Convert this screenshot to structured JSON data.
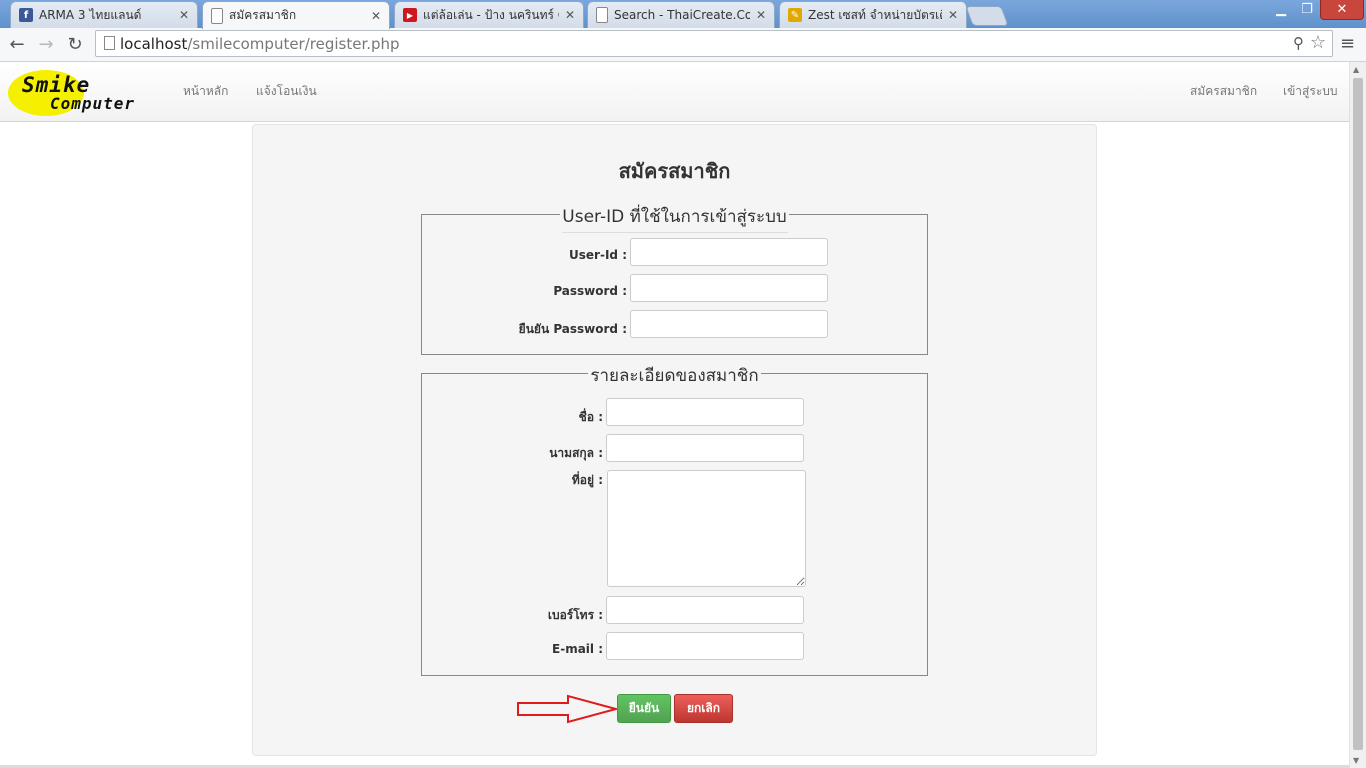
{
  "browser": {
    "tabs": [
      {
        "title": "ARMA 3 ไทยแลนด์",
        "icon": "facebook-icon",
        "color": "#3b5998"
      },
      {
        "title": "สมัครสมาชิก",
        "icon": "page-icon",
        "color": "#888888"
      },
      {
        "title": "แต่ล้อเล่น - ป้าง นครินทร์ Offi",
        "icon": "youtube-icon",
        "color": "#cc181e"
      },
      {
        "title": "Search - ThaiCreate.Com",
        "icon": "page-icon",
        "color": "#888888"
      },
      {
        "title": "Zest เซสท์ จำหน่ายบัตรเติมเงิน",
        "icon": "zest-icon",
        "color": "#e0a800"
      }
    ],
    "url_host": "localhost",
    "url_path": "/smilecomputer/register.php"
  },
  "navbar": {
    "logo_line1": "Smike",
    "logo_line2": "Computer",
    "links_left": [
      "หน้าหลัก",
      "แจ้งโอนเงิน"
    ],
    "links_right": [
      "สมัครสมาชิก",
      "เข้าสู่ระบบ"
    ]
  },
  "form": {
    "title": "สมัครสมาชิก",
    "account_group": {
      "legend": "User-ID ที่ใช้ในการเข้าสู่ระบบ",
      "fields": [
        {
          "label": "User-Id :",
          "value": ""
        },
        {
          "label": "Password :",
          "value": ""
        },
        {
          "label": "ยืนยัน Password :",
          "value": ""
        }
      ]
    },
    "details_group": {
      "legend": "รายละเอียดของสมาชิก",
      "fields": [
        {
          "label": "ชื่อ :",
          "value": ""
        },
        {
          "label": "นามสกุล :",
          "value": ""
        },
        {
          "label": "ที่อยู่ :",
          "value": ""
        },
        {
          "label": "เบอร์โทร :",
          "value": ""
        },
        {
          "label": "E-mail :",
          "value": ""
        }
      ]
    },
    "submit_label": "ยืนยัน",
    "cancel_label": "ยกเลิก"
  },
  "colors": {
    "submit": "#5bb75b",
    "cancel": "#da4f49",
    "annotation_arrow": "#e01b1b"
  }
}
